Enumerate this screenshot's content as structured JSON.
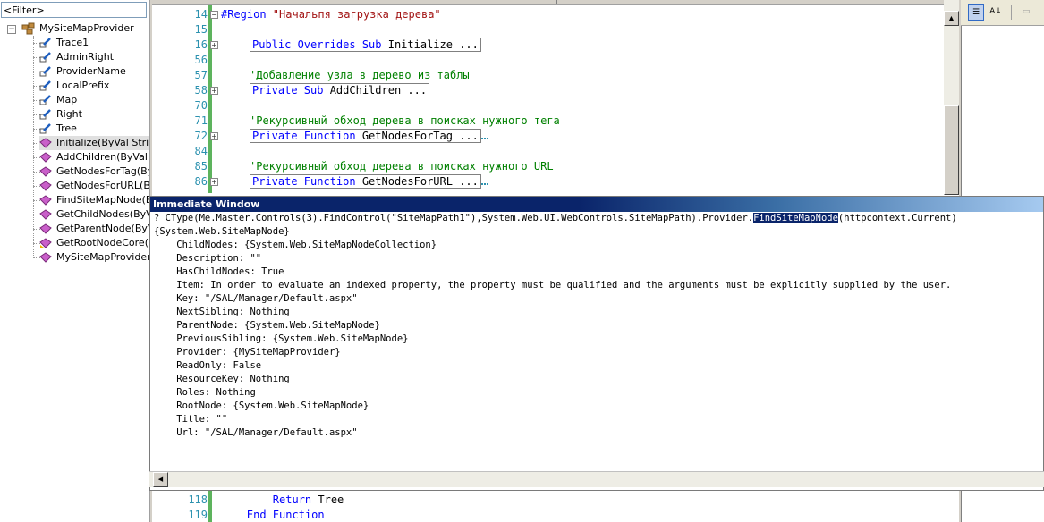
{
  "filter": {
    "text": "<Filter>"
  },
  "tree": {
    "root": "MySiteMapProvider",
    "items": [
      {
        "label": "Trace1",
        "icon": "property-icon"
      },
      {
        "label": "AdminRight",
        "icon": "property-icon"
      },
      {
        "label": "ProviderName",
        "icon": "property-icon"
      },
      {
        "label": "LocalPrefix",
        "icon": "property-icon"
      },
      {
        "label": "Map",
        "icon": "property-icon"
      },
      {
        "label": "Right",
        "icon": "property-icon"
      },
      {
        "label": "Tree",
        "icon": "property-icon"
      },
      {
        "label": "Initialize(ByVal String,",
        "icon": "method-icon"
      },
      {
        "label": "AddChildren(ByVal Int",
        "icon": "method-icon"
      },
      {
        "label": "GetNodesForTag(ByW",
        "icon": "method-icon"
      },
      {
        "label": "GetNodesForURL(ByW",
        "icon": "method-icon"
      },
      {
        "label": "FindSiteMapNode(ByV",
        "icon": "method-icon"
      },
      {
        "label": "GetChildNodes(ByVal",
        "icon": "method-icon"
      },
      {
        "label": "GetParentNode(ByVa",
        "icon": "method-icon"
      },
      {
        "label": "GetRootNodeCore()",
        "icon": "protected-method-icon"
      },
      {
        "label": "MySiteMapProvider_S",
        "icon": "method-icon"
      }
    ]
  },
  "editor": {
    "lines": [
      {
        "num": "14",
        "fold": "-",
        "parts": [
          {
            "t": "#Region ",
            "c": "kw"
          },
          {
            "t": "\"Начальпя загрузка дерева\"",
            "c": "st"
          }
        ]
      },
      {
        "num": "15",
        "fold": "",
        "parts": []
      },
      {
        "num": "16",
        "fold": "+",
        "boxed": true,
        "parts": [
          {
            "t": "Public Overrides Sub ",
            "c": "kw"
          },
          {
            "t": "Initialize ...",
            "c": ""
          }
        ]
      },
      {
        "num": "56",
        "fold": "",
        "parts": []
      },
      {
        "num": "57",
        "fold": "",
        "parts": [
          {
            "t": "'Добавление узла в дерево из таблы",
            "c": "cm"
          }
        ]
      },
      {
        "num": "58",
        "fold": "+",
        "boxed": true,
        "parts": [
          {
            "t": "Private Sub ",
            "c": "kw"
          },
          {
            "t": "AddChildren ...",
            "c": ""
          }
        ]
      },
      {
        "num": "70",
        "fold": "",
        "parts": []
      },
      {
        "num": "71",
        "fold": "",
        "parts": [
          {
            "t": "'Рекурсивный обход дерева в поисках нужного тега",
            "c": "cm"
          }
        ]
      },
      {
        "num": "72",
        "fold": "+",
        "boxed": true,
        "squig": true,
        "parts": [
          {
            "t": "Private Function ",
            "c": "kw"
          },
          {
            "t": "GetNodesForTag ...",
            "c": ""
          }
        ]
      },
      {
        "num": "84",
        "fold": "",
        "parts": []
      },
      {
        "num": "85",
        "fold": "",
        "parts": [
          {
            "t": "'Рекурсивный обход дерева в поисках нужного URL",
            "c": "cm"
          }
        ]
      },
      {
        "num": "86",
        "fold": "+",
        "boxed": true,
        "squig": true,
        "parts": [
          {
            "t": "Private Function ",
            "c": "kw"
          },
          {
            "t": "GetNodesForURL ...",
            "c": ""
          }
        ]
      }
    ],
    "bottom_lines": [
      {
        "num": "118",
        "parts": [
          {
            "t": "        Return ",
            "c": "kw"
          },
          {
            "t": "Tree",
            "c": ""
          }
        ]
      },
      {
        "num": "119",
        "parts": [
          {
            "t": "    End Function",
            "c": "kw"
          }
        ]
      }
    ]
  },
  "immediate": {
    "title": "Immediate Window",
    "command_pre": "? CType(Me.Master.Controls(3).FindControl(\"SiteMapPath1\"),System.Web.UI.WebControls.SiteMapPath).Provider.",
    "command_hl": "FindSiteMapNode",
    "command_post": "(httpcontext.Current)",
    "output": [
      "{System.Web.SiteMapNode}",
      "    ChildNodes: {System.Web.SiteMapNodeCollection}",
      "    Description: \"\"",
      "    HasChildNodes: True",
      "    Item: In order to evaluate an indexed property, the property must be qualified and the arguments must be explicitly supplied by the user.",
      "    Key: \"/SAL/Manager/Default.aspx\"",
      "    NextSibling: Nothing",
      "    ParentNode: {System.Web.SiteMapNode}",
      "    PreviousSibling: {System.Web.SiteMapNode}",
      "    Provider: {MySiteMapProvider}",
      "    ReadOnly: False",
      "    ResourceKey: Nothing",
      "    Roles: Nothing",
      "    RootNode: {System.Web.SiteMapNode}",
      "    Title: \"\"",
      "    Url: \"/SAL/Manager/Default.aspx\""
    ]
  },
  "colors": {
    "keyword": "#0000ff",
    "comment": "#008000",
    "string": "#a31515",
    "linenum": "#2b91af",
    "titlebar": "#0a246a"
  }
}
